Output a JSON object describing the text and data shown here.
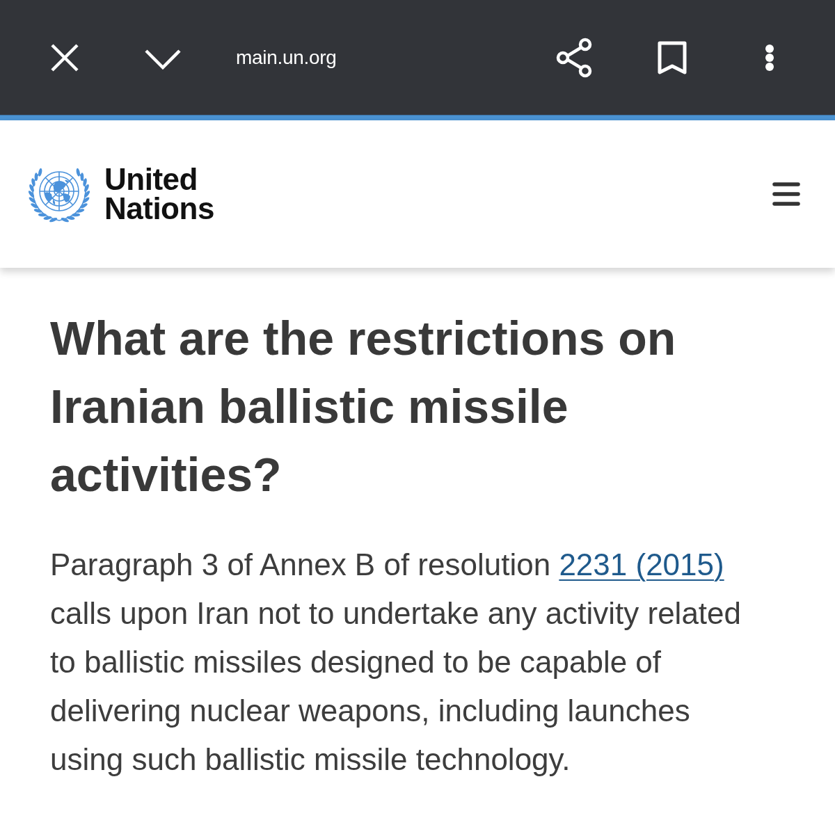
{
  "browser_toolbar": {
    "url": "main.un.org"
  },
  "site_header": {
    "logo_text": "United Nations"
  },
  "article": {
    "title": "What are the restrictions on Iranian ballistic missile activities?",
    "paragraph": [
      {
        "kind": "text",
        "text": "Paragraph 3 of Annex B of resolution "
      },
      {
        "kind": "link",
        "text": "2231 (2015)"
      },
      {
        "kind": "text",
        "text": " calls upon Iran not to undertake any activity related to ballistic missiles designed to be capable of delivering nuclear weapons, including launches using such ballistic missile technology."
      }
    ]
  }
}
